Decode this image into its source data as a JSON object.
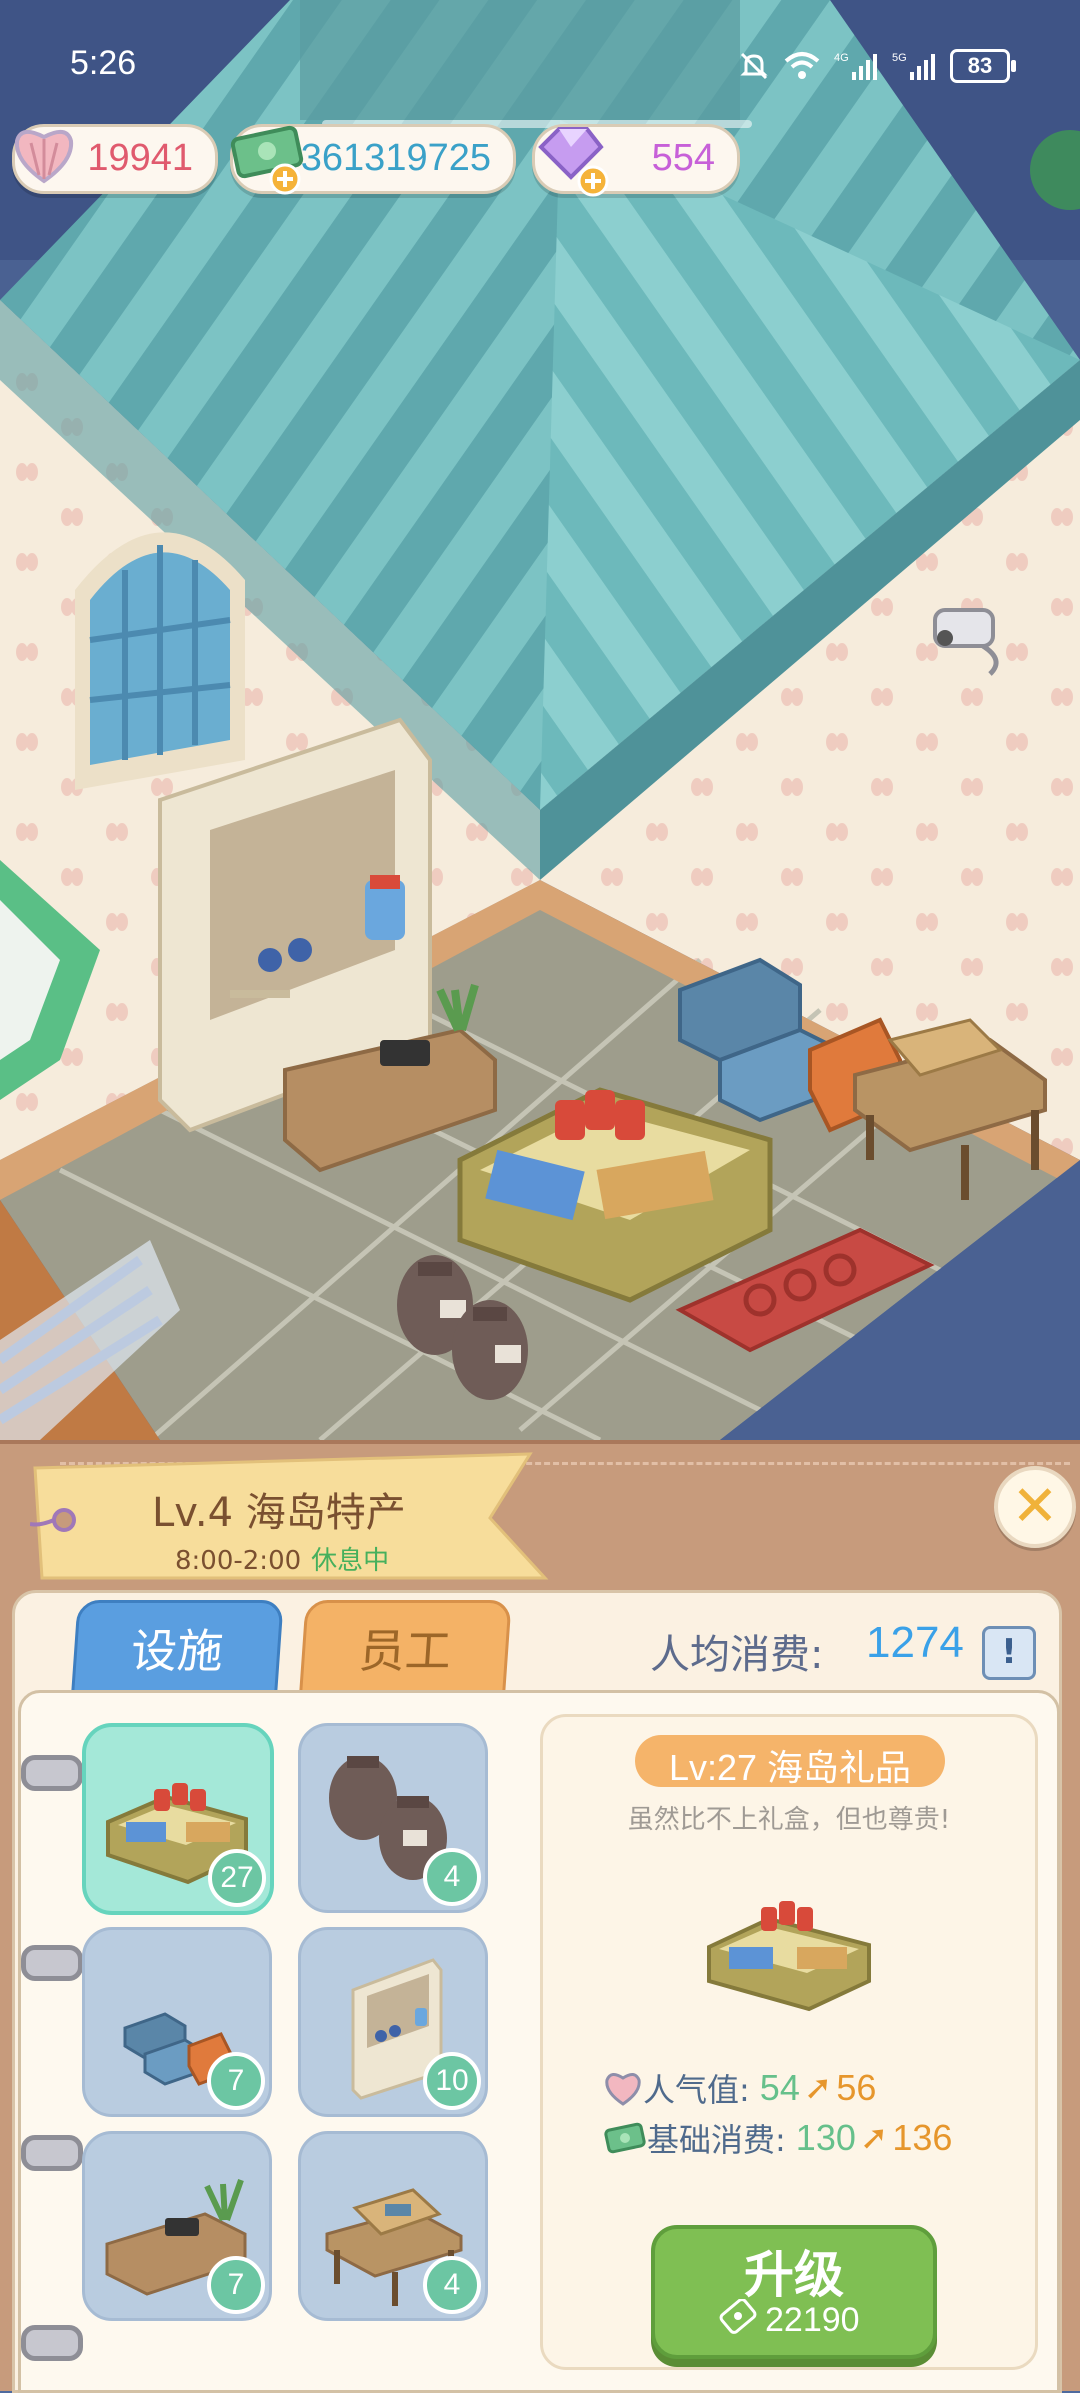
{
  "status_bar": {
    "time": "5:26",
    "battery": "83"
  },
  "currency": {
    "hearts": "19941",
    "cash": "361319725",
    "gems": "554"
  },
  "shop": {
    "title": "Lv.4 海岛特产",
    "hours": "8:00-2:00",
    "state": "休息中"
  },
  "tabs": {
    "facility": "设施",
    "staff": "员工"
  },
  "avg_spend": {
    "label": "人均消费:",
    "value": "1274",
    "info": "!"
  },
  "facilities": [
    {
      "name": "gift-counter",
      "level": "27"
    },
    {
      "name": "clay-jars",
      "level": "4"
    },
    {
      "name": "shoe-boxes",
      "level": "7"
    },
    {
      "name": "display-cabinet",
      "level": "10"
    },
    {
      "name": "cashier-table",
      "level": "7"
    },
    {
      "name": "shoe-table",
      "level": "4"
    }
  ],
  "detail": {
    "name": "Lv:27 海岛礼品",
    "desc": "虽然比不上礼盒，但也尊贵!",
    "popularity": {
      "label": "人气值:",
      "current": "54",
      "next": "56"
    },
    "base_spend": {
      "label": "基础消费:",
      "current": "130",
      "next": "136"
    },
    "upgrade": {
      "label": "升级",
      "cost": "22190"
    }
  },
  "colors": {
    "roof": "#6fb6b9",
    "panel": "#c79b7c",
    "accent_green": "#7fbf53",
    "tab_blue": "#5a9ee0",
    "tab_orange": "#f4b266"
  }
}
